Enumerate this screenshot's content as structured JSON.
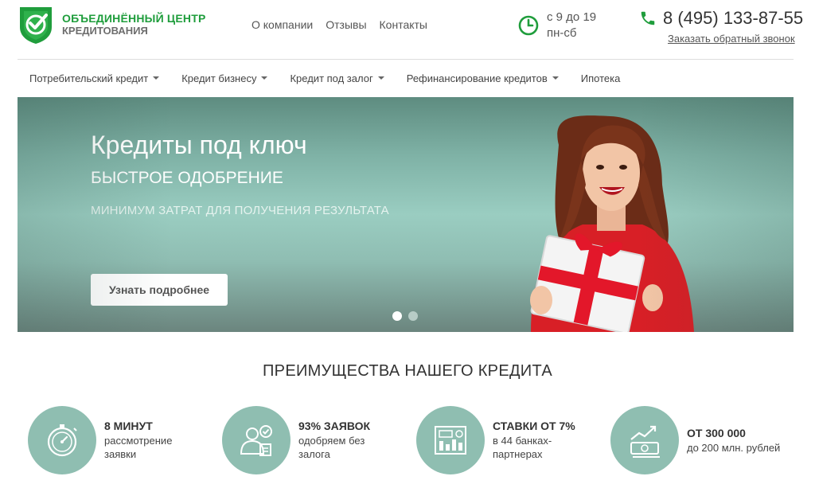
{
  "header": {
    "logo_line1": "ОБЪЕДИНЁННЫЙ ЦЕНТР",
    "logo_line2": "КРЕДИТОВАНИЯ",
    "top_links": [
      "О компании",
      "Отзывы",
      "Контакты"
    ],
    "hours_line1": "с 9 до 19",
    "hours_line2": "пн-сб",
    "phone": "8 (495) 133-87-55",
    "callback": "Заказать обратный звонок"
  },
  "nav": {
    "items": [
      {
        "label": "Потребительский кредит",
        "dropdown": true
      },
      {
        "label": "Кредит бизнесу",
        "dropdown": true
      },
      {
        "label": "Кредит под залог",
        "dropdown": true
      },
      {
        "label": "Рефинансирование кредитов",
        "dropdown": true
      },
      {
        "label": "Ипотека",
        "dropdown": false
      }
    ]
  },
  "hero": {
    "title": "Кредиты под ключ",
    "subtitle": "БЫСТРОЕ ОДОБРЕНИЕ",
    "subtitle2": "МИНИМУМ ЗАТРАТ ДЛЯ ПОЛУЧЕНИЯ РЕЗУЛЬТАТА",
    "button": "Узнать подробнее",
    "slides_total": 2,
    "slide_active": 1
  },
  "advantages": {
    "title": "ПРЕИМУЩЕСТВА НАШЕГО КРЕДИТА",
    "items": [
      {
        "icon": "stopwatch-icon",
        "head": "8 МИНУТ",
        "line1": "рассмотрение",
        "line2": "заявки"
      },
      {
        "icon": "approved-person-icon",
        "head": "93% ЗАЯВОК",
        "line1": "одобряем без",
        "line2": "залога"
      },
      {
        "icon": "calculator-icon",
        "head": "СТАВКИ ОТ 7%",
        "line1": "в 44 банках-",
        "line2": "партнерах"
      },
      {
        "icon": "money-growth-icon",
        "head": "ОТ 300 000",
        "line1": "до 200 млн. рублей",
        "line2": ""
      }
    ]
  },
  "colors": {
    "brand_green": "#1f9d3c",
    "accent_teal": "#8fbeb1"
  }
}
